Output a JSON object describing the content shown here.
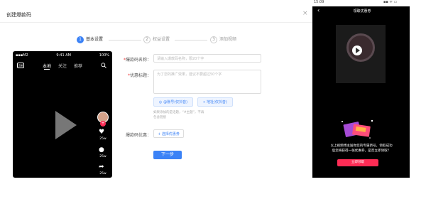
{
  "dialog": {
    "title": "创建爆款码",
    "close": "×"
  },
  "steps": [
    {
      "num": "1",
      "label": "基本设置"
    },
    {
      "num": "2",
      "label": "权益设置"
    },
    {
      "num": "3",
      "label": "添加视频"
    }
  ],
  "phone": {
    "carrier": "▪▪▪M2",
    "time": "9:41 AM",
    "battery": "100%",
    "logo": "直播",
    "tabs": [
      "本地",
      "关注",
      "推荐"
    ],
    "counts": [
      "25w",
      "25w",
      "25w"
    ]
  },
  "form": {
    "name_label": "爆款码名称：",
    "name_placeholder": "请输入爆款码名称，限20个字",
    "desc_label": "优惠标题：",
    "desc_placeholder": "为了您的推广效果，建议不要超过50个字",
    "chip1": "@账号(仅抖音)",
    "chip2": "地址(仅抖音)",
    "hint_line1": "如果添加的是话题，“#主题”，不再",
    "hint_line2": "包含链接",
    "coupon_label": "爆款码优惠：",
    "coupon_button": "+ 选择优惠券",
    "next_button": "下一步"
  },
  "preview": {
    "status_time": "15:09",
    "status_icons": "▪▪ ᯤ ▭",
    "back": "‹",
    "title": "领取优惠券",
    "text_line1": "以上视频博主送你您的专属新号，领取成功",
    "text_line2": "后您将获得一张优惠券，是否立即领取？",
    "button": "立即领取"
  },
  "colors": {
    "primary": "#3b82f6",
    "accent": "#fe2c55"
  }
}
